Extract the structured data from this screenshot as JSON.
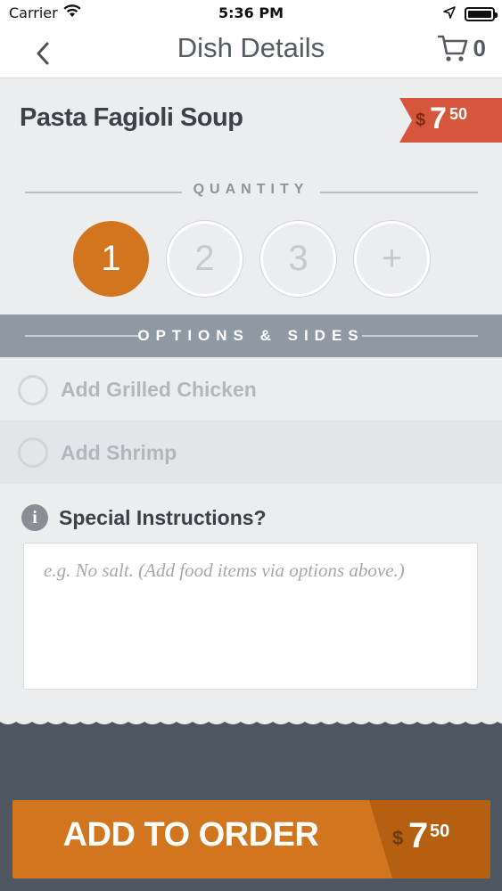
{
  "status_bar": {
    "carrier": "Carrier",
    "time": "5:36 PM"
  },
  "nav": {
    "title": "Dish Details",
    "cart_count": "0"
  },
  "dish": {
    "name": "Pasta Fagioli Soup",
    "price_currency": "$",
    "price_whole": "7",
    "price_cents": "50"
  },
  "quantity": {
    "label": "QUANTITY",
    "options": [
      "1",
      "2",
      "3",
      "+"
    ],
    "selected": "1"
  },
  "options": {
    "label": "OPTIONS & SIDES",
    "items": [
      {
        "label": "Add Grilled Chicken",
        "checked": false
      },
      {
        "label": "Add Shrimp",
        "checked": false
      }
    ]
  },
  "special_instructions": {
    "label": "Special Instructions?",
    "placeholder": "e.g. No salt. (Add food items via options above.)",
    "value": ""
  },
  "order_button": {
    "label": "ADD TO ORDER",
    "price_currency": "$",
    "price_whole": "7",
    "price_cents": "50"
  },
  "colors": {
    "accent": "#d2751f",
    "price_tag": "#d5563a",
    "band": "#8e99a4",
    "footer": "#4e5761"
  }
}
